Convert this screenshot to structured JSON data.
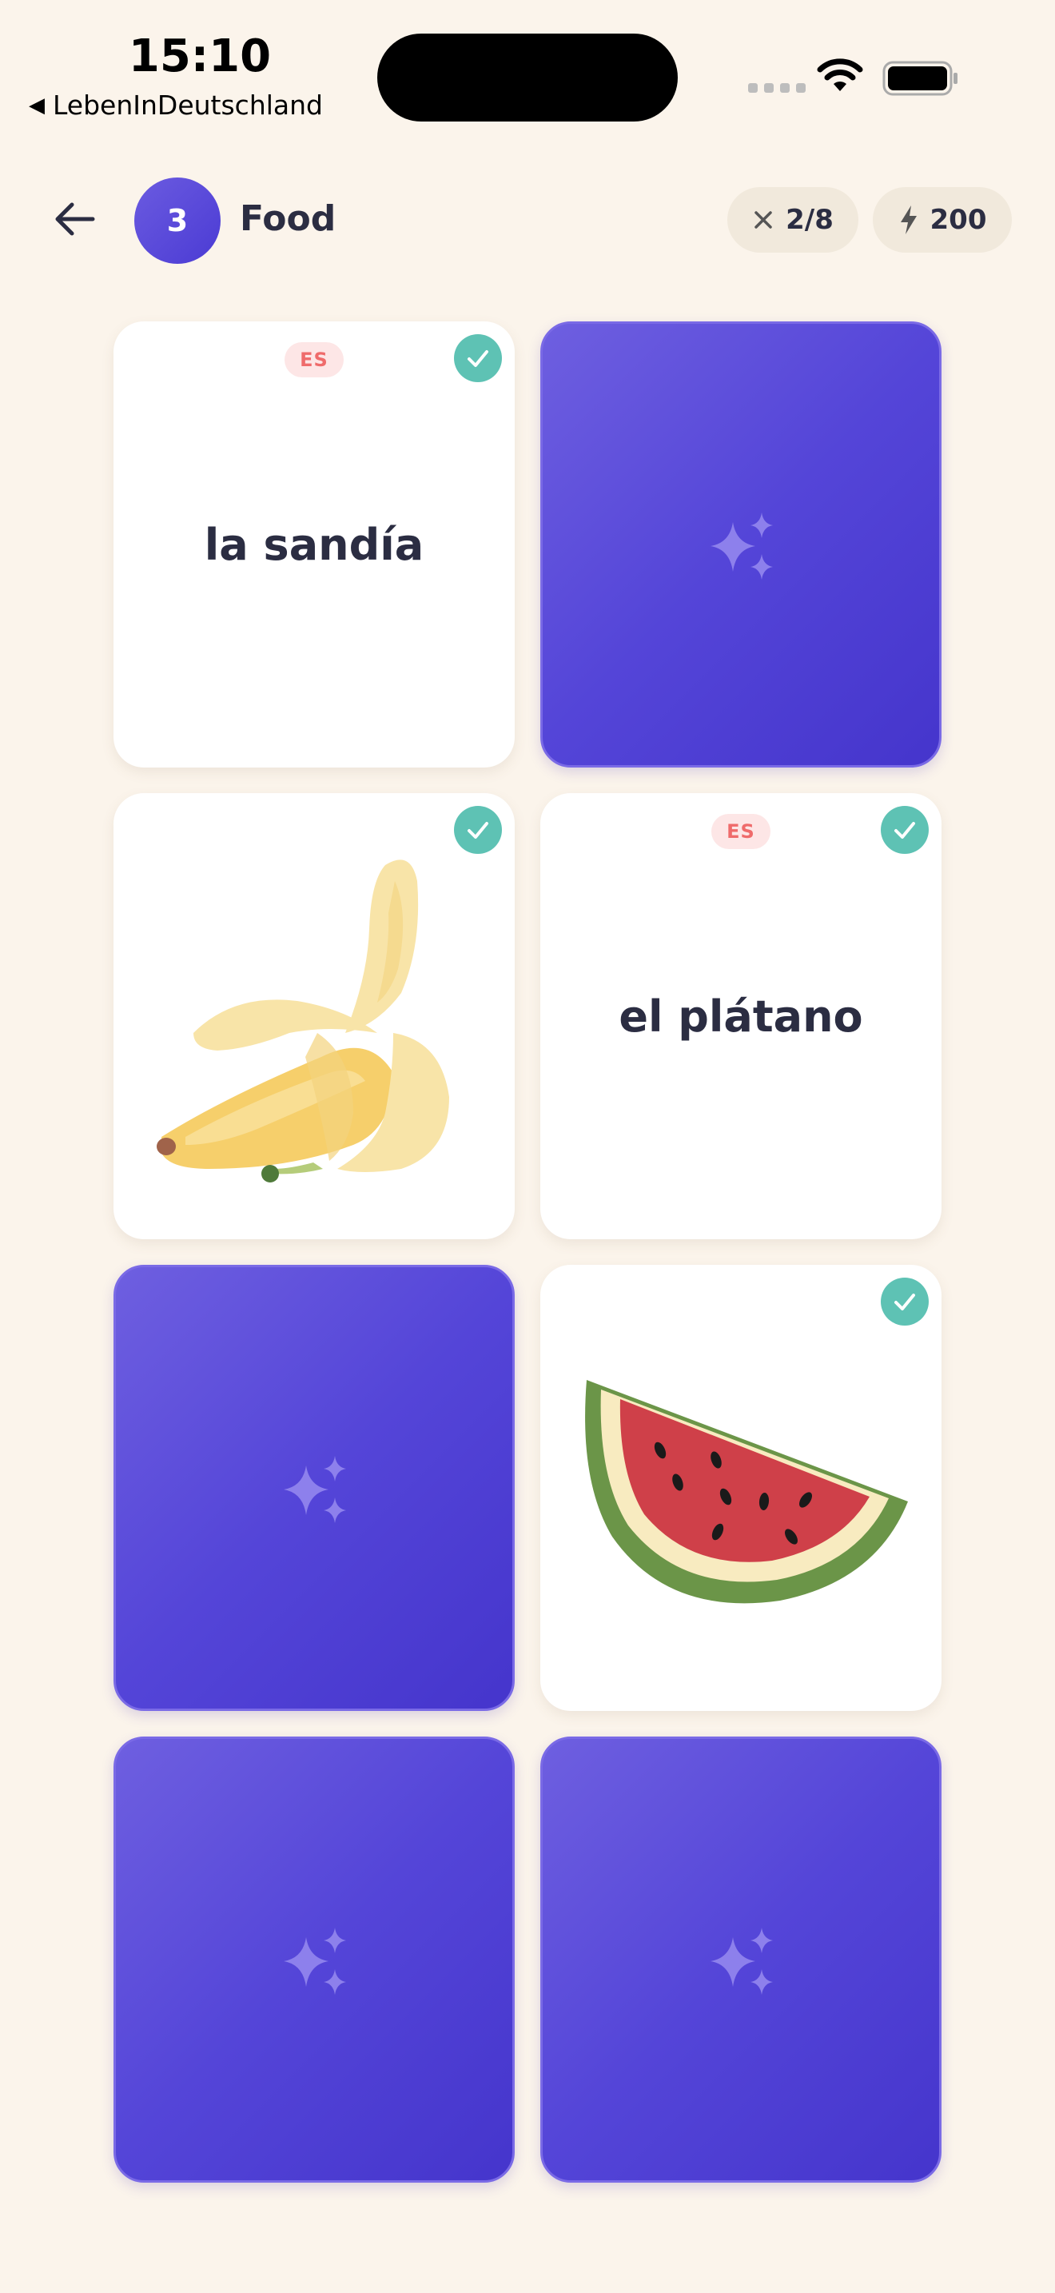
{
  "status_bar": {
    "time": "15:10",
    "back_app": "LebenInDeutschland"
  },
  "header": {
    "level": "3",
    "title": "Food",
    "mistakes": "2/8",
    "xp": "200"
  },
  "cards": [
    {
      "state": "revealed",
      "kind": "word",
      "lang": "ES",
      "text": "la sandía",
      "matched": true
    },
    {
      "state": "hidden"
    },
    {
      "state": "revealed",
      "kind": "image",
      "icon": "banana-image",
      "matched": true
    },
    {
      "state": "revealed",
      "kind": "word",
      "lang": "ES",
      "text": "el plátano",
      "matched": true
    },
    {
      "state": "hidden"
    },
    {
      "state": "revealed",
      "kind": "image",
      "icon": "watermelon-image",
      "matched": true
    },
    {
      "state": "hidden"
    },
    {
      "state": "hidden"
    }
  ],
  "colors": {
    "background": "#fbf4eb",
    "card_back": "#5445d8",
    "check": "#5ec2b4",
    "lang_tag_text": "#ef6b6b"
  }
}
